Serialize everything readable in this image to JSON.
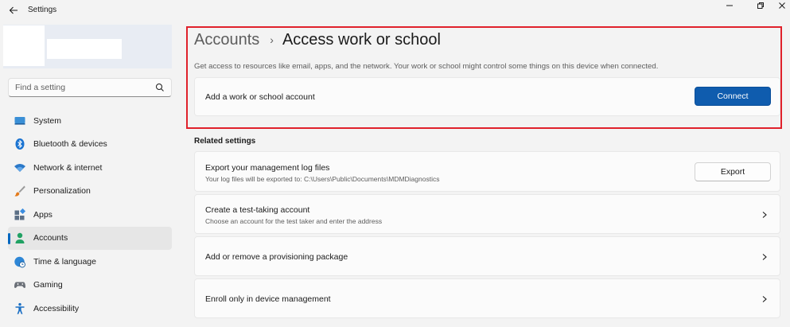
{
  "window": {
    "title": "Settings",
    "controls": [
      "minimize-icon",
      "restore-icon",
      "close-icon"
    ]
  },
  "sidebar": {
    "search_placeholder": "Find a setting",
    "items": [
      {
        "label": "System",
        "icon": "monitor-icon",
        "active": false
      },
      {
        "label": "Bluetooth & devices",
        "icon": "bluetooth-icon",
        "active": false
      },
      {
        "label": "Network & internet",
        "icon": "wifi-icon",
        "active": false
      },
      {
        "label": "Personalization",
        "icon": "brush-icon",
        "active": false
      },
      {
        "label": "Apps",
        "icon": "apps-icon",
        "active": false
      },
      {
        "label": "Accounts",
        "icon": "person-icon",
        "active": true
      },
      {
        "label": "Time & language",
        "icon": "globe-clock-icon",
        "active": false
      },
      {
        "label": "Gaming",
        "icon": "gamepad-icon",
        "active": false
      },
      {
        "label": "Accessibility",
        "icon": "accessibility-icon",
        "active": false
      }
    ]
  },
  "main": {
    "breadcrumb": {
      "parent": "Accounts",
      "separator": "›",
      "current": "Access work or school"
    },
    "description": "Get access to resources like email, apps, and the network. Your work or school might control some things on this device when connected.",
    "add_account": {
      "label": "Add a work or school account",
      "button": "Connect"
    },
    "related_title": "Related settings",
    "related": [
      {
        "title": "Export your management log files",
        "subtitle": "Your log files will be exported to: C:\\Users\\Public\\Documents\\MDMDiagnostics",
        "button": "Export"
      },
      {
        "title": "Create a test-taking account",
        "subtitle": "Choose an account for the test taker and enter the address"
      },
      {
        "title": "Add or remove a provisioning package"
      },
      {
        "title": "Enroll only in device management"
      }
    ]
  },
  "colors": {
    "accent": "#0f5cae",
    "highlight_border": "#e0212b",
    "background": "#f3f3f3"
  }
}
